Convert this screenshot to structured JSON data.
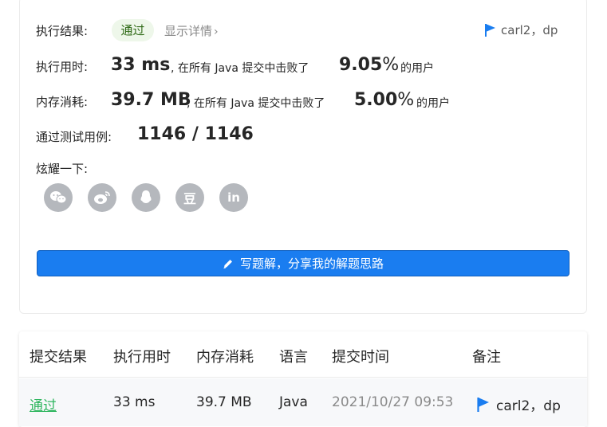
{
  "result": {
    "exec_result_label": "执行结果:",
    "status_badge": "通过",
    "details_link": "显示详情",
    "details_chevron": "›",
    "note": "carl2，dp",
    "runtime_label": "执行用时:",
    "runtime_value": "33 ms",
    "runtime_desc": ", 在所有 Java 提交中击败了",
    "runtime_pct": "9.05",
    "memory_label": "内存消耗:",
    "memory_value": "39.7 MB",
    "memory_desc": ", 在所有 Java 提交中击败了",
    "memory_pct": "5.00",
    "pct_sign": "%",
    "of_users": "的用户",
    "testcases_label": "通过测试用例:",
    "testcases_value": "1146 / 1146",
    "share_label": "炫耀一下:",
    "share_icons": [
      "wechat-icon",
      "weibo-icon",
      "qq-icon",
      "douban-icon",
      "linkedin-icon"
    ],
    "douban_glyph": "豆",
    "linkedin_glyph": "in",
    "write_button": "写题解，分享我的解题思路"
  },
  "table": {
    "headers": [
      "提交结果",
      "执行用时",
      "内存消耗",
      "语言",
      "提交时间",
      "备注"
    ],
    "rows": [
      {
        "status": "通过",
        "runtime": "33 ms",
        "memory": "39.7 MB",
        "language": "Java",
        "time": "2021/10/27 09:53",
        "note": "carl2，dp"
      }
    ]
  },
  "colors": {
    "accent": "#1a7df0",
    "pass_green": "#2db55d",
    "flag_blue": "#1a7df0",
    "icon_gray": "#b5b8bd"
  }
}
